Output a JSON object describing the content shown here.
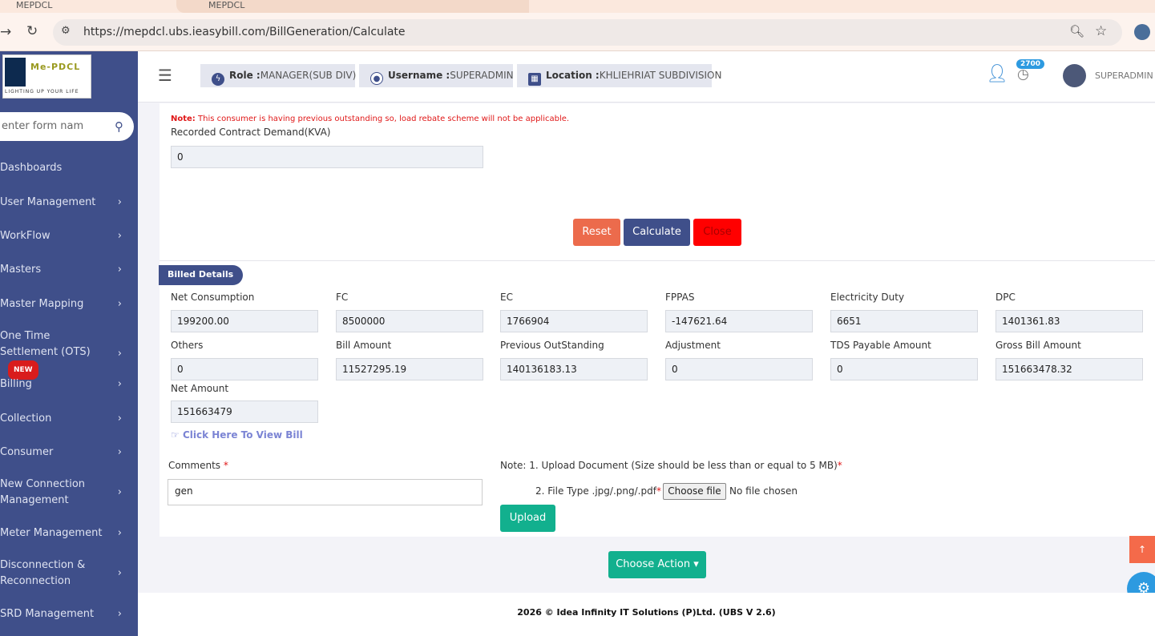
{
  "browser": {
    "tab1": "MEPDCL",
    "tab2": "MEPDCL",
    "url": "https://mepdcl.ubs.ieasybill.com/BillGeneration/Calculate"
  },
  "logo": {
    "text": "Me-PDCL",
    "tagline": "LIGHTING UP YOUR LIFE"
  },
  "sidebar": {
    "search_placeholder": "enter form nam",
    "new_badge": "NEW",
    "items": [
      {
        "label": "Dashboards"
      },
      {
        "label": "User Management"
      },
      {
        "label": "WorkFlow"
      },
      {
        "label": "Masters"
      },
      {
        "label": "Master Mapping"
      },
      {
        "label": "One Time Settlement (OTS)"
      },
      {
        "label": "Billing"
      },
      {
        "label": "Collection"
      },
      {
        "label": "Consumer"
      },
      {
        "label": "New Connection Management"
      },
      {
        "label": "Meter Management"
      },
      {
        "label": "Disconnection & Reconnection"
      },
      {
        "label": "SRD Management"
      }
    ]
  },
  "header": {
    "role_label": "Role :",
    "role": "MANAGER(SUB DIV)",
    "username_label": "Username :",
    "username": "SUPERADMIN",
    "location_label": "Location :",
    "location": "KHLIEHRIAT SUBDIVISION",
    "notif_count": "2700",
    "user": "SUPERADMIN"
  },
  "form": {
    "note_label": "Note:",
    "note": "This consumer is having previous outstanding so, load rebate scheme will not be applicable.",
    "rcd_label": "Recorded Contract Demand(KVA)",
    "rcd_value": "0",
    "reset": "Reset",
    "calculate": "Calculate",
    "close": "Close"
  },
  "billed": {
    "title": "Billed Details",
    "fields": [
      {
        "label": "Net Consumption",
        "value": "199200.00"
      },
      {
        "label": "FC",
        "value": "8500000"
      },
      {
        "label": "EC",
        "value": "1766904"
      },
      {
        "label": "FPPAS",
        "value": "-147621.64"
      },
      {
        "label": "Electricity Duty",
        "value": "6651"
      },
      {
        "label": "DPC",
        "value": "1401361.83"
      },
      {
        "label": "Others",
        "value": "0"
      },
      {
        "label": "Bill Amount",
        "value": "11527295.19"
      },
      {
        "label": "Previous OutStanding",
        "value": "140136183.13"
      },
      {
        "label": "Adjustment",
        "value": "0"
      },
      {
        "label": "TDS Payable Amount",
        "value": "0"
      },
      {
        "label": "Gross Bill Amount",
        "value": "151663478.32"
      },
      {
        "label": "Net Amount",
        "value": "151663479"
      }
    ],
    "view_bill": "Click Here To View Bill",
    "comments_label": "Comments",
    "comments_value": "gen",
    "upload_note1": "Note: 1. Upload Document (Size should be less than or equal to 5 MB)",
    "upload_note2": "2. File Type .jpg/.png/.pdf",
    "choose_file": "Choose file",
    "no_file": "No file chosen",
    "upload": "Upload"
  },
  "choose_action": "Choose Action",
  "footer": "2026 © Idea Infinity IT Solutions (P)Ltd. (UBS V 2.6)"
}
